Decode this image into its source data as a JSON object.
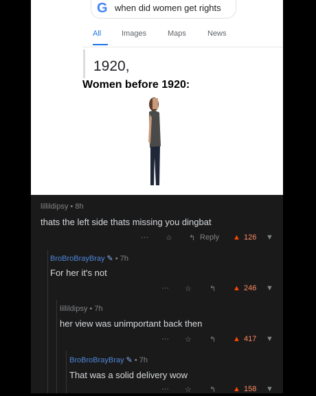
{
  "meme": {
    "search_query": "when did women get rights",
    "google_letter": "G",
    "tabs": [
      "All",
      "Images",
      "Maps",
      "News"
    ],
    "answer": "1920,",
    "caption": "Women before 1920:"
  },
  "comments": [
    {
      "user": "lillildipsy",
      "time": "8h",
      "text": "thats the left side thats missing you dingbat",
      "score": "126",
      "reply_label": "Reply",
      "more": "···"
    },
    {
      "user": "BroBroBrayBray",
      "time": "7h",
      "text": "For her it's not",
      "score": "246",
      "more": "···"
    },
    {
      "user": "lillildipsy",
      "time": "7h",
      "text": "her view was unimportant back then",
      "score": "417",
      "more": "···"
    },
    {
      "user": "BroBroBrayBray",
      "time": "7h",
      "text": "That was a solid delivery wow",
      "score": "158",
      "more": "···"
    }
  ],
  "icons": {
    "upvote": "▲",
    "downvote": "▼",
    "reply": "↰",
    "award": "☆",
    "mod": "hammer-icon"
  },
  "colors": {
    "background": "#1a1a1b",
    "upvoted": "#ff4500",
    "username_blue": "#4f86d8"
  },
  "separator": "•"
}
